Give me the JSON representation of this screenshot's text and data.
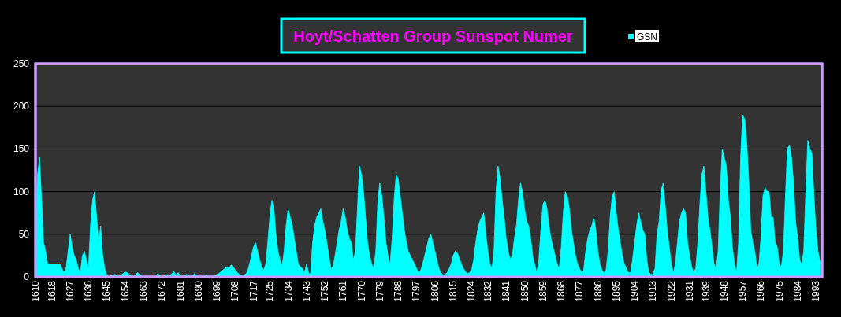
{
  "chart_data": {
    "type": "area",
    "title": "Hoyt/Schatten Group Sunspot Numer",
    "xlim": [
      1610,
      1996
    ],
    "ylim": [
      0,
      250
    ],
    "grid": "y",
    "yticks": [
      0,
      50,
      100,
      150,
      200,
      250
    ],
    "xticks": [
      1610,
      1618,
      1627,
      1636,
      1645,
      1654,
      1663,
      1672,
      1681,
      1690,
      1699,
      1708,
      1717,
      1725,
      1734,
      1743,
      1752,
      1761,
      1770,
      1779,
      1788,
      1797,
      1806,
      1815,
      1824,
      1832,
      1841,
      1850,
      1859,
      1868,
      1877,
      1886,
      1895,
      1904,
      1913,
      1922,
      1931,
      1939,
      1948,
      1957,
      1966,
      1975,
      1984,
      1993
    ],
    "x": [
      1610,
      1611,
      1612,
      1613,
      1614,
      1615,
      1616,
      1617,
      1618,
      1619,
      1620,
      1621,
      1622,
      1623,
      1624,
      1625,
      1626,
      1627,
      1628,
      1629,
      1630,
      1631,
      1632,
      1633,
      1634,
      1635,
      1636,
      1637,
      1638,
      1639,
      1640,
      1641,
      1642,
      1643,
      1644,
      1645,
      1646,
      1647,
      1648,
      1649,
      1650,
      1651,
      1652,
      1653,
      1654,
      1655,
      1656,
      1657,
      1658,
      1659,
      1660,
      1661,
      1662,
      1663,
      1664,
      1665,
      1666,
      1667,
      1668,
      1669,
      1670,
      1671,
      1672,
      1673,
      1674,
      1675,
      1676,
      1677,
      1678,
      1679,
      1680,
      1681,
      1682,
      1683,
      1684,
      1685,
      1686,
      1687,
      1688,
      1689,
      1690,
      1691,
      1692,
      1693,
      1694,
      1695,
      1696,
      1697,
      1698,
      1699,
      1700,
      1701,
      1702,
      1703,
      1704,
      1705,
      1706,
      1707,
      1708,
      1709,
      1710,
      1711,
      1712,
      1713,
      1714,
      1715,
      1716,
      1717,
      1718,
      1719,
      1720,
      1721,
      1722,
      1723,
      1724,
      1725,
      1726,
      1727,
      1728,
      1729,
      1730,
      1731,
      1732,
      1733,
      1734,
      1735,
      1736,
      1737,
      1738,
      1739,
      1740,
      1741,
      1742,
      1743,
      1744,
      1745,
      1746,
      1747,
      1748,
      1749,
      1750,
      1751,
      1752,
      1753,
      1754,
      1755,
      1756,
      1757,
      1758,
      1759,
      1760,
      1761,
      1762,
      1763,
      1764,
      1765,
      1766,
      1767,
      1768,
      1769,
      1770,
      1771,
      1772,
      1773,
      1774,
      1775,
      1776,
      1777,
      1778,
      1779,
      1780,
      1781,
      1782,
      1783,
      1784,
      1785,
      1786,
      1787,
      1788,
      1789,
      1790,
      1791,
      1792,
      1793,
      1794,
      1795,
      1796,
      1797,
      1798,
      1799,
      1800,
      1801,
      1802,
      1803,
      1804,
      1805,
      1806,
      1807,
      1808,
      1809,
      1810,
      1811,
      1812,
      1813,
      1814,
      1815,
      1816,
      1817,
      1818,
      1819,
      1820,
      1821,
      1822,
      1823,
      1824,
      1825,
      1826,
      1827,
      1828,
      1829,
      1830,
      1831,
      1832,
      1833,
      1834,
      1835,
      1836,
      1837,
      1838,
      1839,
      1840,
      1841,
      1842,
      1843,
      1844,
      1845,
      1846,
      1847,
      1848,
      1849,
      1850,
      1851,
      1852,
      1853,
      1854,
      1855,
      1856,
      1857,
      1858,
      1859,
      1860,
      1861,
      1862,
      1863,
      1864,
      1865,
      1866,
      1867,
      1868,
      1869,
      1870,
      1871,
      1872,
      1873,
      1874,
      1875,
      1876,
      1877,
      1878,
      1879,
      1880,
      1881,
      1882,
      1883,
      1884,
      1885,
      1886,
      1887,
      1888,
      1889,
      1890,
      1891,
      1892,
      1893,
      1894,
      1895,
      1896,
      1897,
      1898,
      1899,
      1900,
      1901,
      1902,
      1903,
      1904,
      1905,
      1906,
      1907,
      1908,
      1909,
      1910,
      1911,
      1912,
      1913,
      1914,
      1915,
      1916,
      1917,
      1918,
      1919,
      1920,
      1921,
      1922,
      1923,
      1924,
      1925,
      1926,
      1927,
      1928,
      1929,
      1930,
      1931,
      1932,
      1933,
      1934,
      1935,
      1936,
      1937,
      1938,
      1939,
      1940,
      1941,
      1942,
      1943,
      1944,
      1945,
      1946,
      1947,
      1948,
      1949,
      1950,
      1951,
      1952,
      1953,
      1954,
      1955,
      1956,
      1957,
      1958,
      1959,
      1960,
      1961,
      1962,
      1963,
      1964,
      1965,
      1966,
      1967,
      1968,
      1969,
      1970,
      1971,
      1972,
      1973,
      1974,
      1975,
      1976,
      1977,
      1978,
      1979,
      1980,
      1981,
      1982,
      1983,
      1984,
      1985,
      1986,
      1987,
      1988,
      1989,
      1990,
      1991,
      1992,
      1993,
      1994,
      1995
    ],
    "series": [
      {
        "name": "GSN",
        "color": "#00ffff",
        "values": [
          60,
          120,
          140,
          90,
          40,
          30,
          15,
          15,
          15,
          15,
          15,
          15,
          15,
          10,
          5,
          10,
          30,
          50,
          35,
          25,
          20,
          10,
          5,
          25,
          30,
          20,
          10,
          60,
          90,
          100,
          70,
          40,
          60,
          25,
          10,
          2,
          0,
          1,
          2,
          3,
          1,
          0,
          2,
          4,
          6,
          5,
          3,
          1,
          0,
          2,
          5,
          3,
          1,
          0,
          1,
          0,
          0,
          0,
          0,
          0,
          4,
          2,
          0,
          1,
          3,
          0,
          2,
          4,
          6,
          2,
          5,
          2,
          0,
          1,
          3,
          2,
          0,
          1,
          4,
          2,
          0,
          0,
          0,
          1,
          2,
          0,
          0,
          0,
          1,
          3,
          4,
          6,
          8,
          10,
          12,
          10,
          14,
          12,
          8,
          5,
          3,
          2,
          1,
          3,
          6,
          15,
          25,
          35,
          40,
          30,
          20,
          12,
          8,
          15,
          40,
          70,
          90,
          80,
          50,
          30,
          20,
          12,
          30,
          60,
          80,
          70,
          60,
          45,
          30,
          15,
          12,
          10,
          5,
          15,
          5,
          3,
          40,
          60,
          70,
          75,
          80,
          65,
          55,
          40,
          25,
          10,
          12,
          25,
          40,
          55,
          65,
          80,
          70,
          55,
          45,
          40,
          20,
          30,
          80,
          130,
          120,
          100,
          70,
          40,
          25,
          15,
          10,
          30,
          90,
          110,
          95,
          70,
          40,
          25,
          15,
          45,
          90,
          120,
          115,
          95,
          75,
          55,
          40,
          30,
          25,
          20,
          15,
          10,
          5,
          8,
          15,
          25,
          35,
          45,
          50,
          40,
          30,
          20,
          10,
          5,
          2,
          3,
          5,
          10,
          15,
          25,
          30,
          28,
          22,
          15,
          10,
          6,
          4,
          5,
          8,
          20,
          40,
          55,
          65,
          70,
          75,
          50,
          30,
          15,
          10,
          30,
          100,
          130,
          115,
          90,
          70,
          45,
          30,
          20,
          25,
          45,
          60,
          90,
          110,
          100,
          80,
          65,
          60,
          45,
          25,
          15,
          5,
          20,
          55,
          85,
          90,
          80,
          60,
          45,
          35,
          25,
          15,
          10,
          35,
          75,
          100,
          95,
          80,
          55,
          40,
          25,
          15,
          10,
          5,
          8,
          30,
          45,
          55,
          60,
          70,
          55,
          30,
          15,
          8,
          5,
          8,
          30,
          70,
          95,
          100,
          75,
          55,
          40,
          25,
          15,
          10,
          5,
          5,
          20,
          40,
          60,
          75,
          65,
          55,
          50,
          20,
          5,
          3,
          3,
          10,
          50,
          65,
          100,
          110,
          85,
          55,
          35,
          15,
          5,
          15,
          40,
          65,
          75,
          80,
          75,
          40,
          25,
          12,
          5,
          10,
          40,
          85,
          120,
          130,
          100,
          70,
          55,
          35,
          15,
          10,
          30,
          100,
          150,
          140,
          130,
          90,
          70,
          35,
          15,
          5,
          40,
          140,
          190,
          185,
          160,
          115,
          55,
          40,
          30,
          10,
          15,
          45,
          95,
          105,
          100,
          100,
          70,
          70,
          40,
          35,
          15,
          12,
          30,
          95,
          150,
          155,
          140,
          110,
          65,
          45,
          20,
          15,
          30,
          100,
          160,
          150,
          145,
          95,
          55,
          30,
          18
        ]
      }
    ]
  }
}
